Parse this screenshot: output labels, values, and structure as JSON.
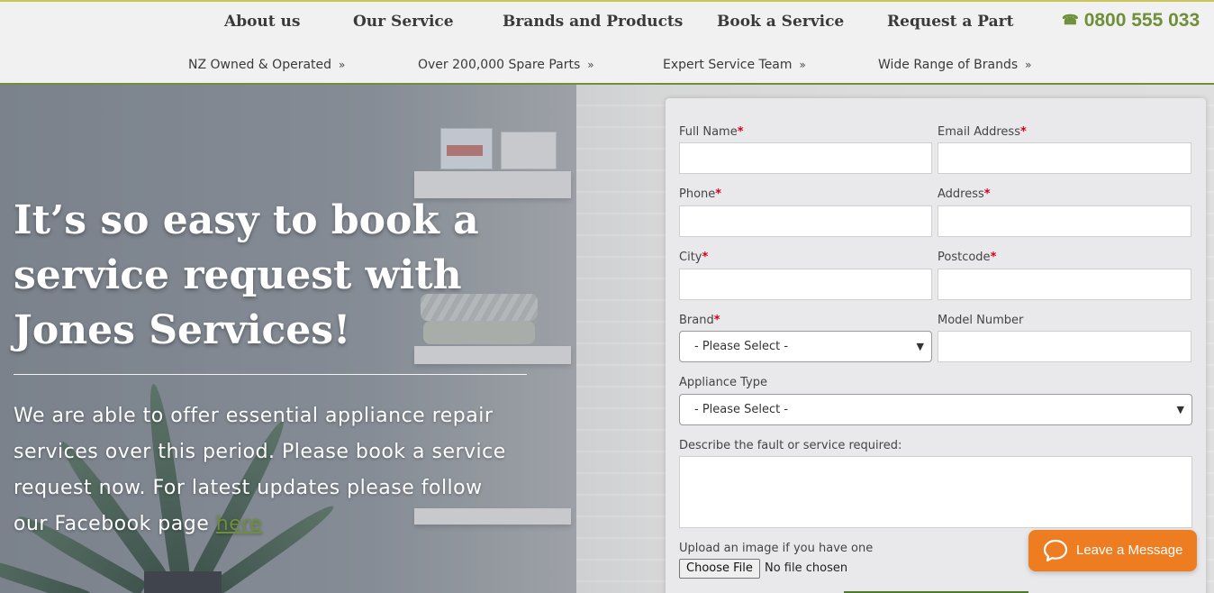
{
  "nav": {
    "items": [
      "About us",
      "Our Service",
      "Brands and Products",
      "Book a Service",
      "Request a Part"
    ],
    "phone": "0800 555 033",
    "phone_icon": "telephone-icon"
  },
  "subnav": {
    "items": [
      "NZ Owned & Operated",
      "Over 200,000 Spare Parts",
      "Expert Service Team",
      "Wide Range of Brands"
    ],
    "arrow_icon": "double-chevron-right-icon"
  },
  "hero": {
    "headline_lines": [
      "It’s so easy to book a",
      "service request with",
      "Jones Services!"
    ],
    "intro_lines": [
      "We are able to offer essential appliance repair",
      "services over this period. Please book a service",
      "request now. For latest updates please follow",
      "our Facebook page "
    ],
    "link_text": "here"
  },
  "form": {
    "full_name_label": "Full Name",
    "email_label": "Email Address",
    "phone_label": "Phone",
    "address_label": "Address",
    "city_label": "City",
    "postcode_label": "Postcode",
    "brand_label": "Brand",
    "brand_value": "- Please Select -",
    "model_label": "Model Number",
    "appliance_label": "Appliance Type",
    "appliance_value": "- Please Select -",
    "fault_label": "Describe the fault or service required:",
    "upload_label": "Upload an image if you have one",
    "file_button": "Choose File",
    "file_status": "No file chosen",
    "required_mark": "*"
  },
  "chat": {
    "label": "Leave a Message",
    "icon": "speech-bubble-icon"
  },
  "colors": {
    "accent_green": "#6f8f3a",
    "required_red": "#d0021b",
    "chat_orange": "#ee7d22"
  }
}
